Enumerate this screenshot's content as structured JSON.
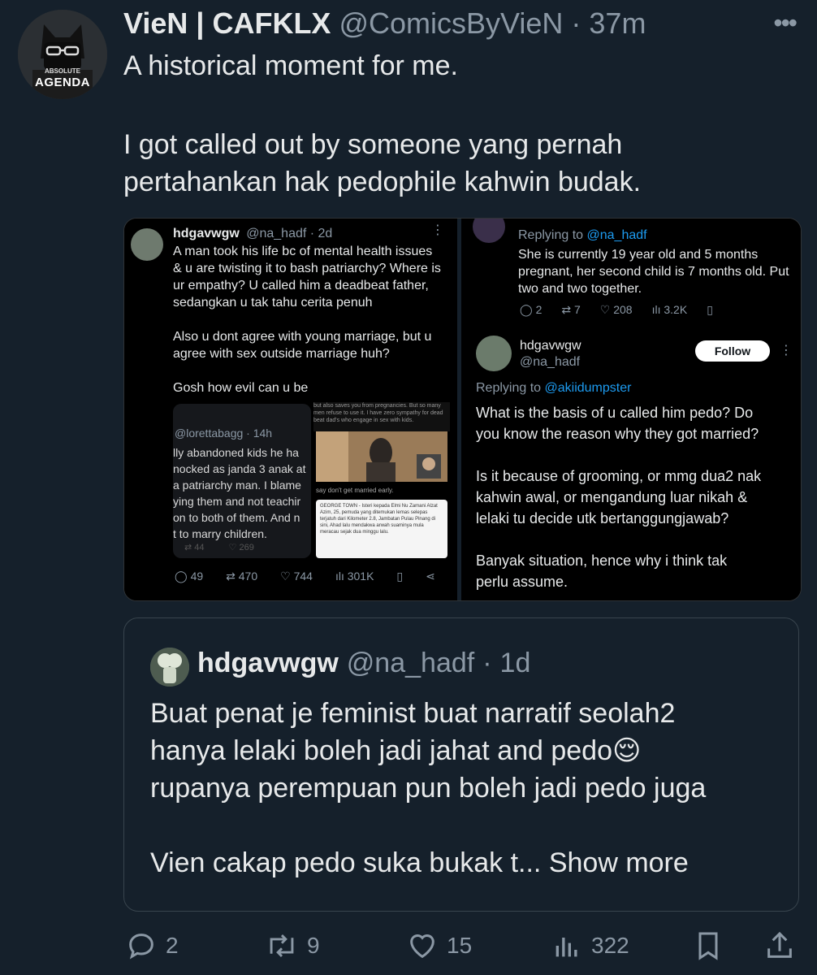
{
  "tweet": {
    "author": {
      "name": "VieN | CAFKLX",
      "handle": "@ComicsByVieN",
      "separator": "·",
      "time": "37m"
    },
    "avatar": {
      "small_text": "ABSOLUTE",
      "text": "AGENDA"
    },
    "text_line1": "A historical moment for me.",
    "text_line2": "I got called out by someone yang pernah",
    "text_line3": "pertahankan hak pedophile kahwin budak.",
    "stats": {
      "replies": "2",
      "retweets": "9",
      "likes": "15",
      "views": "322"
    }
  },
  "media": {
    "left": {
      "name": "hdgavwgw",
      "handle": "@na_hadf · 2d",
      "lines": [
        "A man took his life bc of mental health issues",
        "& u are twisting it to bash patriarchy? Where is",
        "ur empathy? U called him a deadbeat father,",
        "sedangkan u tak tahu cerita penuh",
        "",
        "Also u dont agree with young marriage, but u",
        "agree with sex outside marriage huh?",
        "",
        "Gosh how evil can u be"
      ],
      "embedded_handle": "@lorettabagg · 14h",
      "embedded_lines": [
        "lly abandoned kids he ha",
        "nocked as janda 3 anak at",
        "a patriarchy man. I blame",
        "ying them and not teachir",
        "on to both of them. And n",
        "t to marry children."
      ],
      "embedded_stats": {
        "retweets": "44",
        "likes": "269"
      },
      "news_caption": "say don't get married early.",
      "news_text": "GEORGE TOWN - Isteri kepada Elmi Nu Zamani Alzat Azim, 25, pemuda yang ditemukan lemas selepas terjatuh dari Kilometer 2.8, Jambatan Pulau Pinang di sini, Ahad lalu mendakwa arwah suaminya mula meracau sejak dua minggu lalu.",
      "top_snippet": "but also saves you from pregnancies. But so many men refuse to use it. I have zero sympathy for dead beat dad's who engage in sex with kids.",
      "stats": {
        "replies": "49",
        "retweets": "470",
        "likes": "744",
        "views": "301K"
      }
    },
    "right": {
      "top_reply_to_label": "Replying to ",
      "top_reply_to_handle": "@na_hadf",
      "top_lines": [
        "She is currently 19 year old and 5 months",
        "pregnant, her second child is 7 months old. Put",
        "two and two together."
      ],
      "top_stats": {
        "replies": "2",
        "retweets": "7",
        "likes": "208",
        "views": "3.2K"
      },
      "name": "hdgavwgw",
      "handle": "@na_hadf",
      "follow_label": "Follow",
      "reply_to_label": "Replying to ",
      "reply_to_handle": "@akiidumpster",
      "lines": [
        "What is the basis of u called him pedo? Do",
        "you know the reason why they got married?",
        "",
        "Is it because of grooming, or mmg dua2 nak",
        "kahwin awal, or mengandung luar nikah &",
        "lelaki tu decide utk bertanggungjawab?",
        "",
        "Banyak situation, hence why i think tak",
        "perlu assume."
      ]
    }
  },
  "quote": {
    "name": "hdgavwgw",
    "handle": "@na_hadf",
    "separator": "·",
    "time": "1d",
    "line1": "Buat penat je feminist buat narratif seolah2",
    "line2": "hanya lelaki boleh jadi jahat and pedo",
    "emoji": "😌",
    "line3": "rupanya perempuan pun boleh jadi pedo juga",
    "line4": "Vien cakap pedo suka bukak t...",
    "show_more": "Show more"
  },
  "colors": {
    "background": "#15202b",
    "text": "#e7e9ea",
    "muted": "#8b98a5",
    "link": "#1d9bf0"
  },
  "icons": [
    "reply-icon",
    "retweet-icon",
    "like-icon",
    "views-icon",
    "bookmark-icon",
    "share-icon",
    "more-icon"
  ]
}
